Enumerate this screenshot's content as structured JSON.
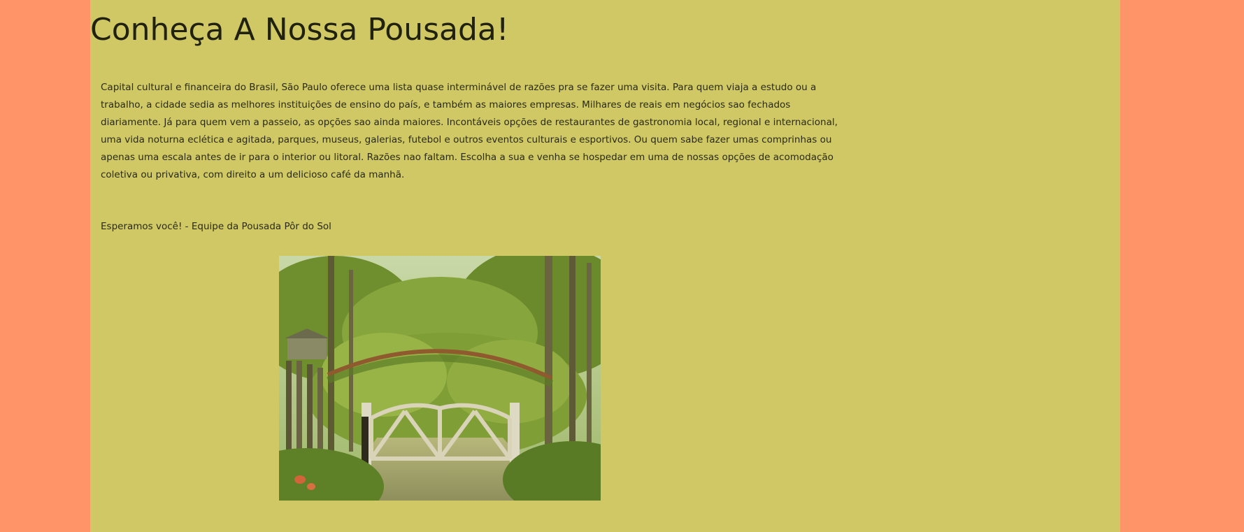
{
  "page": {
    "title": "Conheça A Nossa Pousada!",
    "intro": "Capital cultural e financeira do Brasil, São Paulo oferece uma lista quase interminável de razões pra se fazer uma visita. Para quem viaja a estudo ou a trabalho, a cidade sedia as melhores instituições de ensino do país, e também as maiores empresas. Milhares de reais em negócios sao fechados diariamente. Já para quem vem a passeio, as opções sao ainda maiores. Incontáveis opções de restaurantes de gastronomia local, regional e internacional, uma vida noturna eclética e agitada, parques, museus, galerias, futebol e outros eventos culturais e esportivos. Ou quem sabe fazer umas comprinhas ou apenas uma escala antes de ir para o interior ou litoral. Razões nao faltam. Escolha a sua e venha se hospedar em uma de nossas opções de acomodação coletiva ou privativa, com direito a um delicioso café da manhã.",
    "closing": "Esperamos você! - Equipe da Pousada Pôr do Sol"
  },
  "colors": {
    "outer_background": "#ff9468",
    "content_background": "#cfc865",
    "text": "#21210f"
  },
  "photo": {
    "subject": "garden entrance gate with vine arch and trees"
  }
}
